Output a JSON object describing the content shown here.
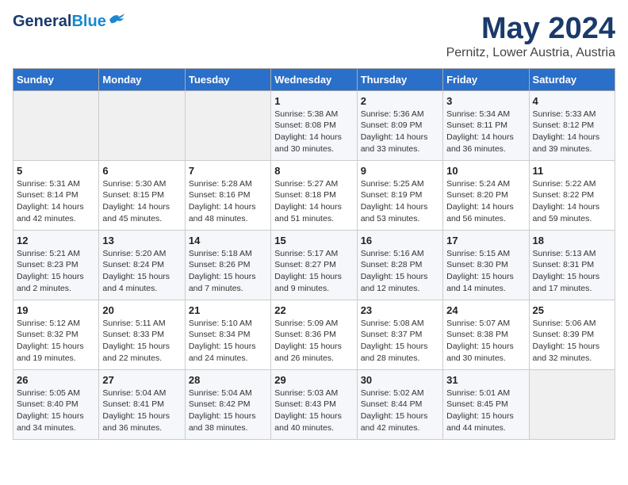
{
  "header": {
    "logo_line1": "General",
    "logo_line2": "Blue",
    "month": "May 2024",
    "location": "Pernitz, Lower Austria, Austria"
  },
  "weekdays": [
    "Sunday",
    "Monday",
    "Tuesday",
    "Wednesday",
    "Thursday",
    "Friday",
    "Saturday"
  ],
  "weeks": [
    [
      {
        "day": "",
        "detail": ""
      },
      {
        "day": "",
        "detail": ""
      },
      {
        "day": "",
        "detail": ""
      },
      {
        "day": "1",
        "detail": "Sunrise: 5:38 AM\nSunset: 8:08 PM\nDaylight: 14 hours\nand 30 minutes."
      },
      {
        "day": "2",
        "detail": "Sunrise: 5:36 AM\nSunset: 8:09 PM\nDaylight: 14 hours\nand 33 minutes."
      },
      {
        "day": "3",
        "detail": "Sunrise: 5:34 AM\nSunset: 8:11 PM\nDaylight: 14 hours\nand 36 minutes."
      },
      {
        "day": "4",
        "detail": "Sunrise: 5:33 AM\nSunset: 8:12 PM\nDaylight: 14 hours\nand 39 minutes."
      }
    ],
    [
      {
        "day": "5",
        "detail": "Sunrise: 5:31 AM\nSunset: 8:14 PM\nDaylight: 14 hours\nand 42 minutes."
      },
      {
        "day": "6",
        "detail": "Sunrise: 5:30 AM\nSunset: 8:15 PM\nDaylight: 14 hours\nand 45 minutes."
      },
      {
        "day": "7",
        "detail": "Sunrise: 5:28 AM\nSunset: 8:16 PM\nDaylight: 14 hours\nand 48 minutes."
      },
      {
        "day": "8",
        "detail": "Sunrise: 5:27 AM\nSunset: 8:18 PM\nDaylight: 14 hours\nand 51 minutes."
      },
      {
        "day": "9",
        "detail": "Sunrise: 5:25 AM\nSunset: 8:19 PM\nDaylight: 14 hours\nand 53 minutes."
      },
      {
        "day": "10",
        "detail": "Sunrise: 5:24 AM\nSunset: 8:20 PM\nDaylight: 14 hours\nand 56 minutes."
      },
      {
        "day": "11",
        "detail": "Sunrise: 5:22 AM\nSunset: 8:22 PM\nDaylight: 14 hours\nand 59 minutes."
      }
    ],
    [
      {
        "day": "12",
        "detail": "Sunrise: 5:21 AM\nSunset: 8:23 PM\nDaylight: 15 hours\nand 2 minutes."
      },
      {
        "day": "13",
        "detail": "Sunrise: 5:20 AM\nSunset: 8:24 PM\nDaylight: 15 hours\nand 4 minutes."
      },
      {
        "day": "14",
        "detail": "Sunrise: 5:18 AM\nSunset: 8:26 PM\nDaylight: 15 hours\nand 7 minutes."
      },
      {
        "day": "15",
        "detail": "Sunrise: 5:17 AM\nSunset: 8:27 PM\nDaylight: 15 hours\nand 9 minutes."
      },
      {
        "day": "16",
        "detail": "Sunrise: 5:16 AM\nSunset: 8:28 PM\nDaylight: 15 hours\nand 12 minutes."
      },
      {
        "day": "17",
        "detail": "Sunrise: 5:15 AM\nSunset: 8:30 PM\nDaylight: 15 hours\nand 14 minutes."
      },
      {
        "day": "18",
        "detail": "Sunrise: 5:13 AM\nSunset: 8:31 PM\nDaylight: 15 hours\nand 17 minutes."
      }
    ],
    [
      {
        "day": "19",
        "detail": "Sunrise: 5:12 AM\nSunset: 8:32 PM\nDaylight: 15 hours\nand 19 minutes."
      },
      {
        "day": "20",
        "detail": "Sunrise: 5:11 AM\nSunset: 8:33 PM\nDaylight: 15 hours\nand 22 minutes."
      },
      {
        "day": "21",
        "detail": "Sunrise: 5:10 AM\nSunset: 8:34 PM\nDaylight: 15 hours\nand 24 minutes."
      },
      {
        "day": "22",
        "detail": "Sunrise: 5:09 AM\nSunset: 8:36 PM\nDaylight: 15 hours\nand 26 minutes."
      },
      {
        "day": "23",
        "detail": "Sunrise: 5:08 AM\nSunset: 8:37 PM\nDaylight: 15 hours\nand 28 minutes."
      },
      {
        "day": "24",
        "detail": "Sunrise: 5:07 AM\nSunset: 8:38 PM\nDaylight: 15 hours\nand 30 minutes."
      },
      {
        "day": "25",
        "detail": "Sunrise: 5:06 AM\nSunset: 8:39 PM\nDaylight: 15 hours\nand 32 minutes."
      }
    ],
    [
      {
        "day": "26",
        "detail": "Sunrise: 5:05 AM\nSunset: 8:40 PM\nDaylight: 15 hours\nand 34 minutes."
      },
      {
        "day": "27",
        "detail": "Sunrise: 5:04 AM\nSunset: 8:41 PM\nDaylight: 15 hours\nand 36 minutes."
      },
      {
        "day": "28",
        "detail": "Sunrise: 5:04 AM\nSunset: 8:42 PM\nDaylight: 15 hours\nand 38 minutes."
      },
      {
        "day": "29",
        "detail": "Sunrise: 5:03 AM\nSunset: 8:43 PM\nDaylight: 15 hours\nand 40 minutes."
      },
      {
        "day": "30",
        "detail": "Sunrise: 5:02 AM\nSunset: 8:44 PM\nDaylight: 15 hours\nand 42 minutes."
      },
      {
        "day": "31",
        "detail": "Sunrise: 5:01 AM\nSunset: 8:45 PM\nDaylight: 15 hours\nand 44 minutes."
      },
      {
        "day": "",
        "detail": ""
      }
    ]
  ]
}
